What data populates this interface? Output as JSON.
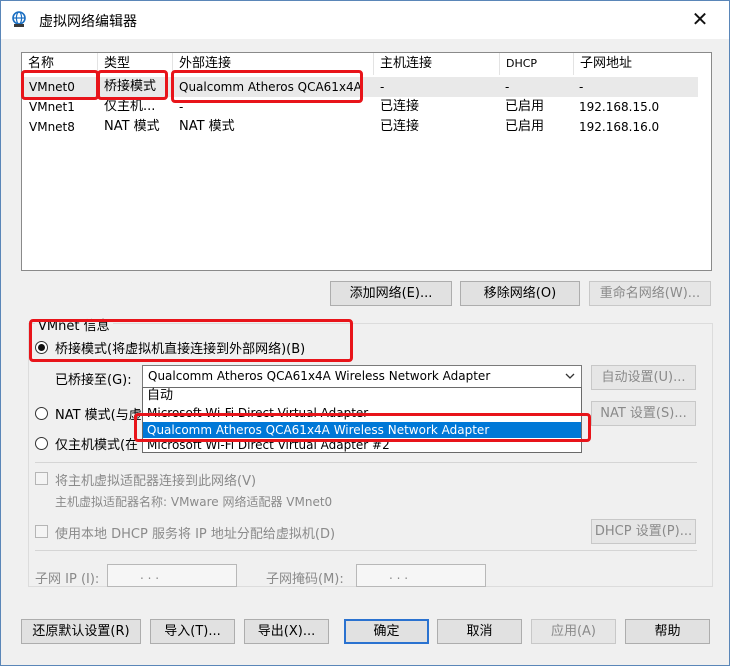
{
  "window": {
    "title": "虚拟网络编辑器",
    "close": "✕"
  },
  "table": {
    "headers": [
      "名称",
      "类型",
      "外部连接",
      "主机连接",
      "DHCP",
      "子网地址"
    ],
    "rows": [
      [
        "VMnet0",
        "桥接模式",
        "Qualcomm Atheros QCA61x4A...",
        "-",
        "-",
        "-"
      ],
      [
        "VMnet1",
        "仅主机...",
        "-",
        "已连接",
        "已启用",
        "192.168.15.0"
      ],
      [
        "VMnet8",
        "NAT 模式",
        "NAT 模式",
        "已连接",
        "已启用",
        "192.168.16.0"
      ]
    ]
  },
  "list_buttons": {
    "add": "添加网络(E)...",
    "remove": "移除网络(O)",
    "rename": "重命名网络(W)..."
  },
  "vmnet_info": {
    "group_label": "VMnet 信息",
    "bridged": "桥接模式(将虚拟机直接连接到外部网络)(B)",
    "bridged_to_label": "已桥接至(G):",
    "bridged_to_value": "Qualcomm Atheros QCA61x4A Wireless Network Adapter",
    "auto_settings": "自动设置(U)...",
    "nat": "NAT 模式(与虚",
    "nat_settings": "NAT 设置(S)...",
    "host_only": "仅主机模式(在",
    "connect_host_adapter": "将主机虚拟适配器连接到此网络(V)",
    "host_adapter_name": "主机虚拟适配器名称: VMware 网络适配器 VMnet0",
    "use_dhcp": "使用本地 DHCP 服务将 IP 地址分配给虚拟机(D)",
    "dhcp_settings": "DHCP 设置(P)...",
    "subnet_ip_label": "子网 IP (I):",
    "subnet_mask_label": "子网掩码(M):",
    "ip_placeholder": ".     .     ."
  },
  "dropdown": {
    "options": [
      "自动",
      "Microsoft Wi-Fi Direct Virtual Adapter",
      "Qualcomm Atheros QCA61x4A Wireless Network Adapter",
      "Microsoft Wi-Fi Direct Virtual Adapter #2"
    ],
    "selected_index": 2
  },
  "footer": {
    "restore": "还原默认设置(R)",
    "import": "导入(T)...",
    "export": "导出(X)...",
    "ok": "确定",
    "cancel": "取消",
    "apply": "应用(A)",
    "help": "帮助"
  },
  "colors": {
    "highlight": "#e8141a",
    "selection": "#0078d7"
  }
}
